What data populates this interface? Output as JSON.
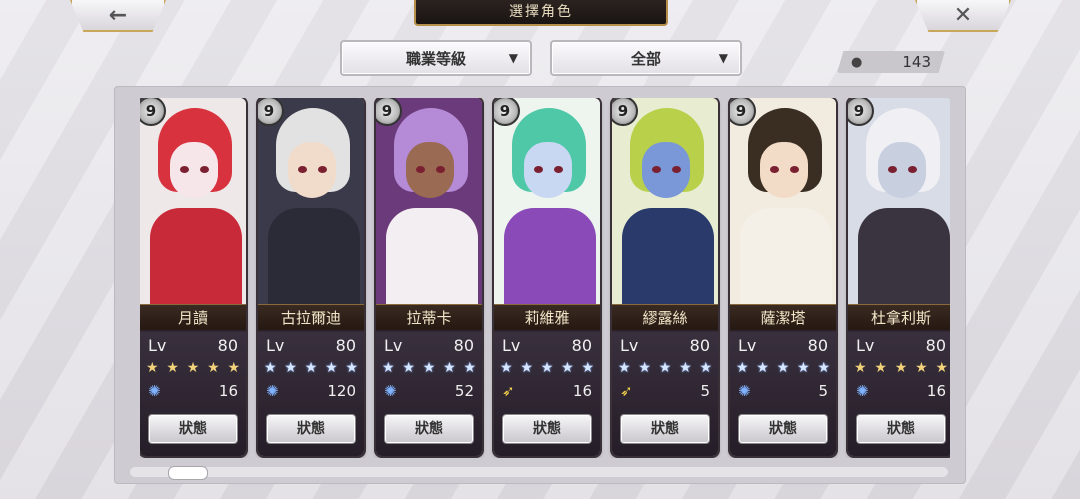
{
  "header": {
    "title": "選擇角色",
    "back_icon": "←",
    "close_icon": "✕"
  },
  "filters": {
    "class_filter": {
      "label": "職業等級",
      "arrow": "▼"
    },
    "category_filter": {
      "label": "全部",
      "arrow": "▼"
    }
  },
  "count": {
    "icon": "person-icon",
    "value": "143"
  },
  "scroll": {
    "position": 0.05
  },
  "cards": [
    {
      "name": "月讀",
      "lv_label": "Lv",
      "level": "80",
      "stars": 5,
      "star_type": "gold",
      "sub_icon": "swirl",
      "sub_value": "16",
      "status_label": "狀態",
      "key": "9",
      "colors": {
        "bg": "#efe8e8",
        "hair": "#d8323f",
        "face": "#f6e6ea",
        "body": "#c92a3a"
      }
    },
    {
      "name": "古拉爾迪",
      "lv_label": "Lv",
      "level": "80",
      "stars": 5,
      "star_type": "blue",
      "sub_icon": "swirl",
      "sub_value": "120",
      "status_label": "狀態",
      "key": "9",
      "colors": {
        "bg": "#3a3a4a",
        "hair": "#e2e2e2",
        "face": "#f1dccc",
        "body": "#2b2b38"
      }
    },
    {
      "name": "拉蒂卡",
      "lv_label": "Lv",
      "level": "80",
      "stars": 5,
      "star_type": "blue",
      "sub_icon": "swirl",
      "sub_value": "52",
      "status_label": "狀態",
      "key": "9",
      "colors": {
        "bg": "#6a3a7a",
        "hair": "#b58ad6",
        "face": "#9a6a52",
        "body": "#f3eef2"
      }
    },
    {
      "name": "莉維雅",
      "lv_label": "Lv",
      "level": "80",
      "stars": 5,
      "star_type": "blue",
      "sub_icon": "feather",
      "sub_value": "16",
      "status_label": "狀態",
      "key": "9",
      "colors": {
        "bg": "#eef4ee",
        "hair": "#4fc8a8",
        "face": "#c8d8f2",
        "body": "#8a4ab8"
      }
    },
    {
      "name": "繆露絲",
      "lv_label": "Lv",
      "level": "80",
      "stars": 5,
      "star_type": "blue",
      "sub_icon": "feather",
      "sub_value": "5",
      "status_label": "狀態",
      "key": "9",
      "colors": {
        "bg": "#e8ecd0",
        "hair": "#b8d04a",
        "face": "#7a98d8",
        "body": "#2a3a6a"
      }
    },
    {
      "name": "薩潔塔",
      "lv_label": "Lv",
      "level": "80",
      "stars": 5,
      "star_type": "blue",
      "sub_icon": "swirl",
      "sub_value": "5",
      "status_label": "狀態",
      "key": "9",
      "colors": {
        "bg": "#f2ece0",
        "hair": "#3a2e22",
        "face": "#f2dcc8",
        "body": "#f4f0e8"
      }
    },
    {
      "name": "杜拿利斯",
      "lv_label": "Lv",
      "level": "80",
      "stars": 5,
      "star_type": "gold",
      "sub_icon": "swirl",
      "sub_value": "16",
      "status_label": "狀態",
      "key": "9",
      "colors": {
        "bg": "#d8dce6",
        "hair": "#f0f0f4",
        "face": "#c8d0e0",
        "body": "#3a3440"
      }
    }
  ]
}
